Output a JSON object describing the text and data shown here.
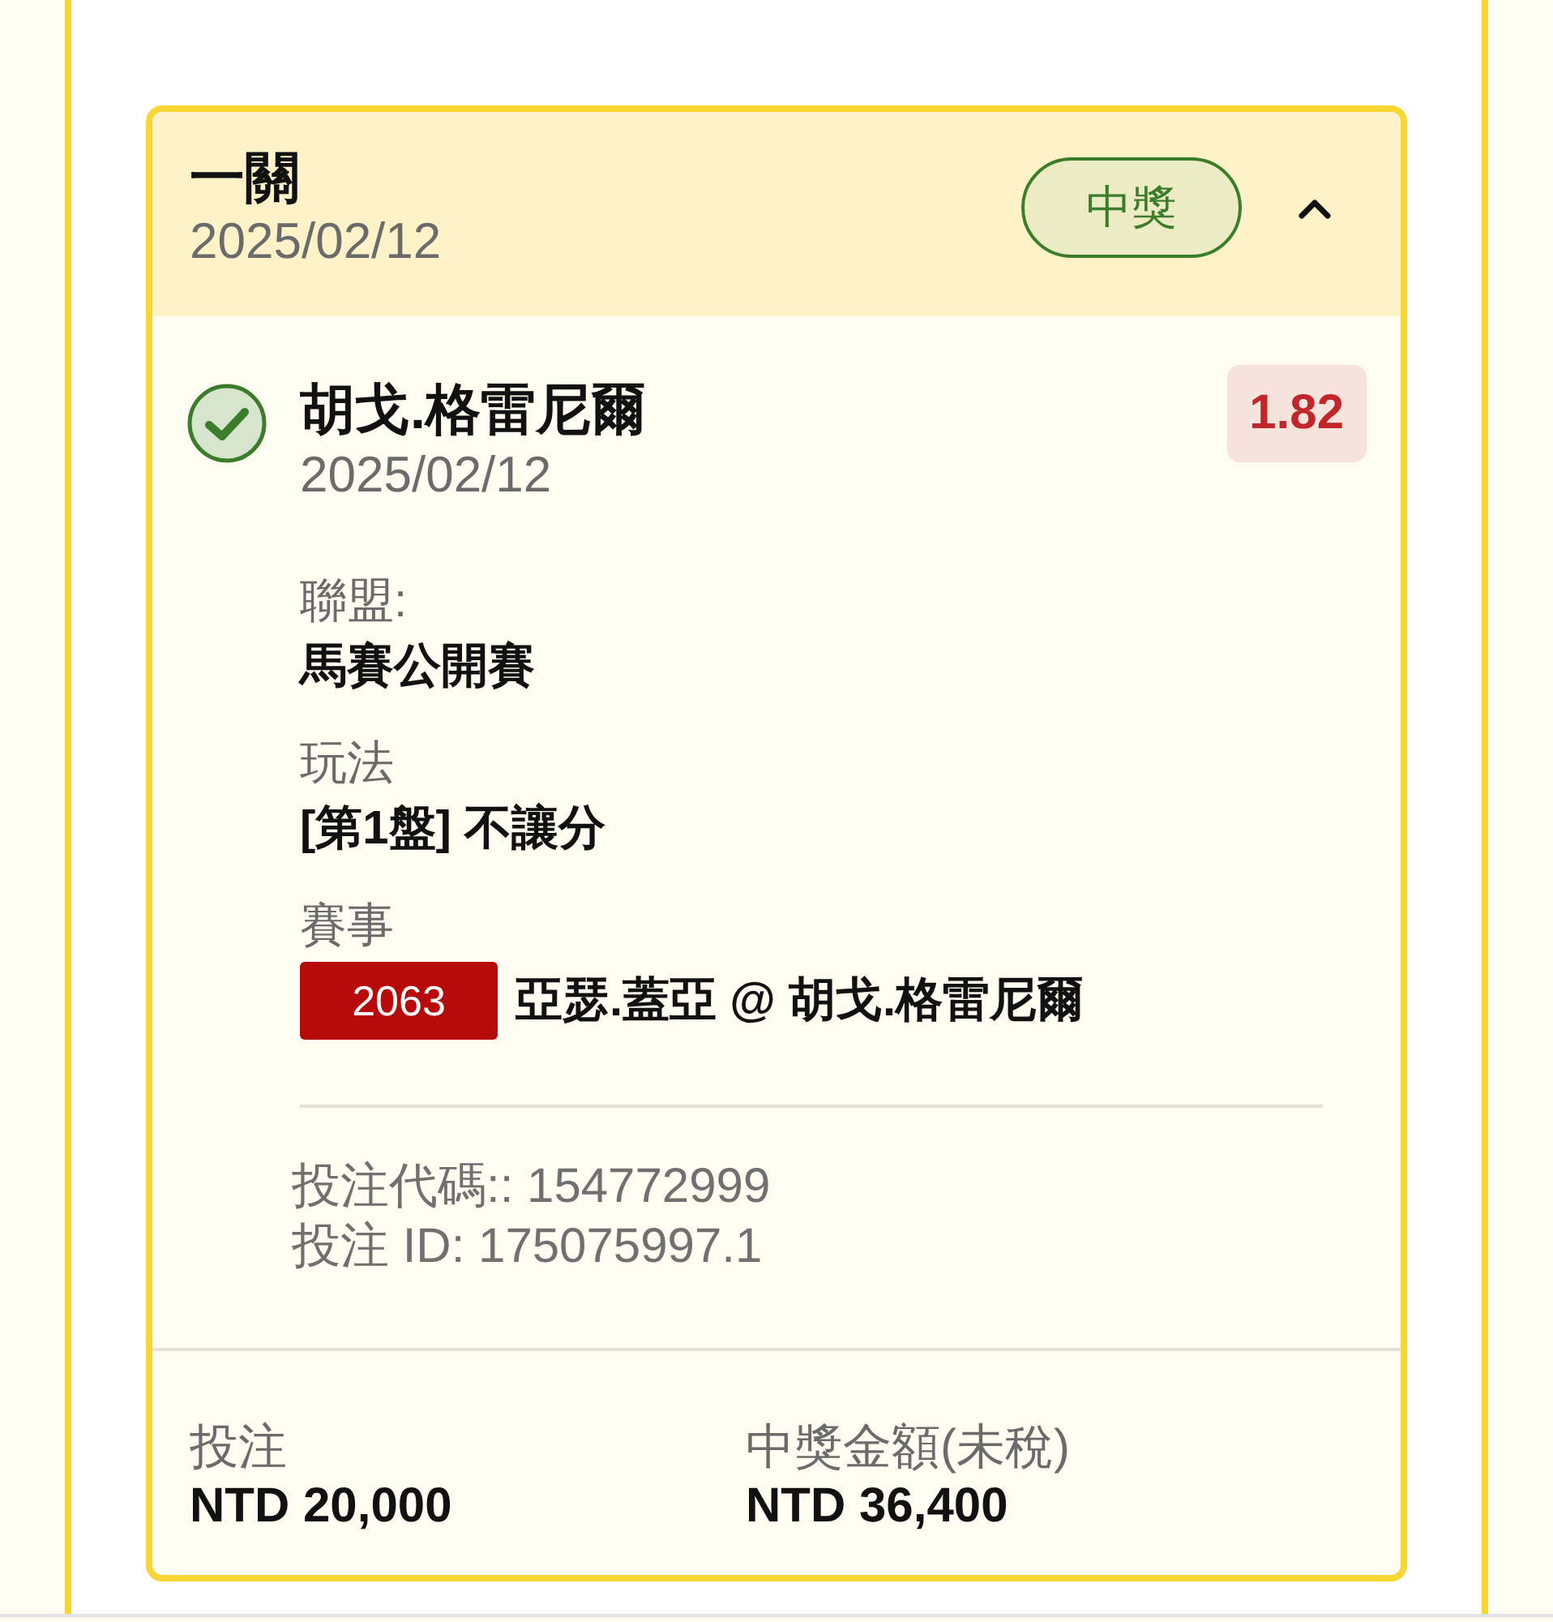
{
  "bet_card": {
    "title": "一關",
    "date": "2025/02/12",
    "status": {
      "label": "中獎",
      "kind": "won"
    },
    "expanded": true,
    "selection": {
      "kind": "won",
      "name": "胡戈.格雷尼爾",
      "date": "2025/02/12",
      "odds": "1.82"
    },
    "details": [
      {
        "kind": "text",
        "label": "聯盟:",
        "value": "馬賽公開賽"
      },
      {
        "kind": "text",
        "label": "玩法",
        "value": "[第1盤] 不讓分"
      },
      {
        "kind": "match",
        "label": "賽事",
        "match_code": "2063",
        "value": "亞瑟.蓋亞 @ 胡戈.格雷尼爾"
      }
    ],
    "references": [
      "投注代碼:: 154772999",
      "投注 ID: 175075997.1"
    ],
    "totals": [
      {
        "label": "投注",
        "value": "NTD 20,000"
      },
      {
        "label": "中獎金額(未稅)",
        "value": "NTD 36,400"
      }
    ]
  }
}
